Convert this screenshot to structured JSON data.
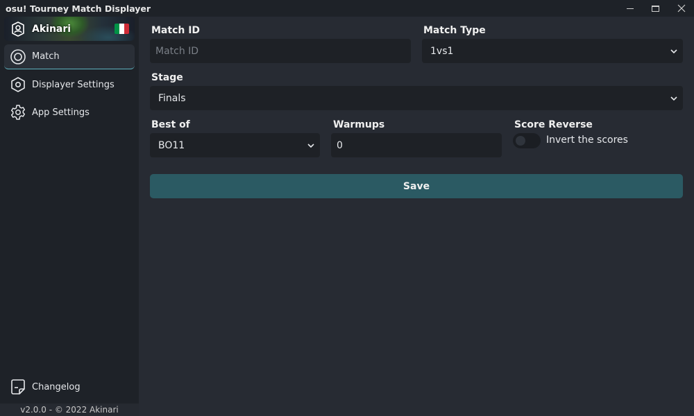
{
  "window": {
    "title": "osu! Tourney Match Displayer"
  },
  "profile": {
    "username": "Akinari",
    "flag_colors": [
      "#009246",
      "#ffffff",
      "#ce2b37"
    ]
  },
  "sidebar": {
    "items": [
      {
        "label": "Match",
        "icon": "target-icon",
        "active": true
      },
      {
        "label": "Displayer Settings",
        "icon": "hexagon-gear-icon",
        "active": false
      },
      {
        "label": "App Settings",
        "icon": "gear-icon",
        "active": false
      }
    ],
    "changelog": {
      "label": "Changelog",
      "icon": "note-icon"
    },
    "version": "v2.0.0  - © 2022 Akinari"
  },
  "form": {
    "match_id": {
      "label": "Match ID",
      "value": "",
      "placeholder": "Match ID"
    },
    "match_type": {
      "label": "Match Type",
      "value": "1vs1"
    },
    "stage": {
      "label": "Stage",
      "value": "Finals"
    },
    "best_of": {
      "label": "Best of",
      "value": "BO11"
    },
    "warmups": {
      "label": "Warmups",
      "value": "0"
    },
    "score_reverse": {
      "label": "Score Reverse",
      "toggle_label": "Invert the scores",
      "enabled": false
    },
    "save_label": "Save"
  },
  "colors": {
    "accent": "#5fb3c0",
    "save_button": "#2b5a63"
  }
}
